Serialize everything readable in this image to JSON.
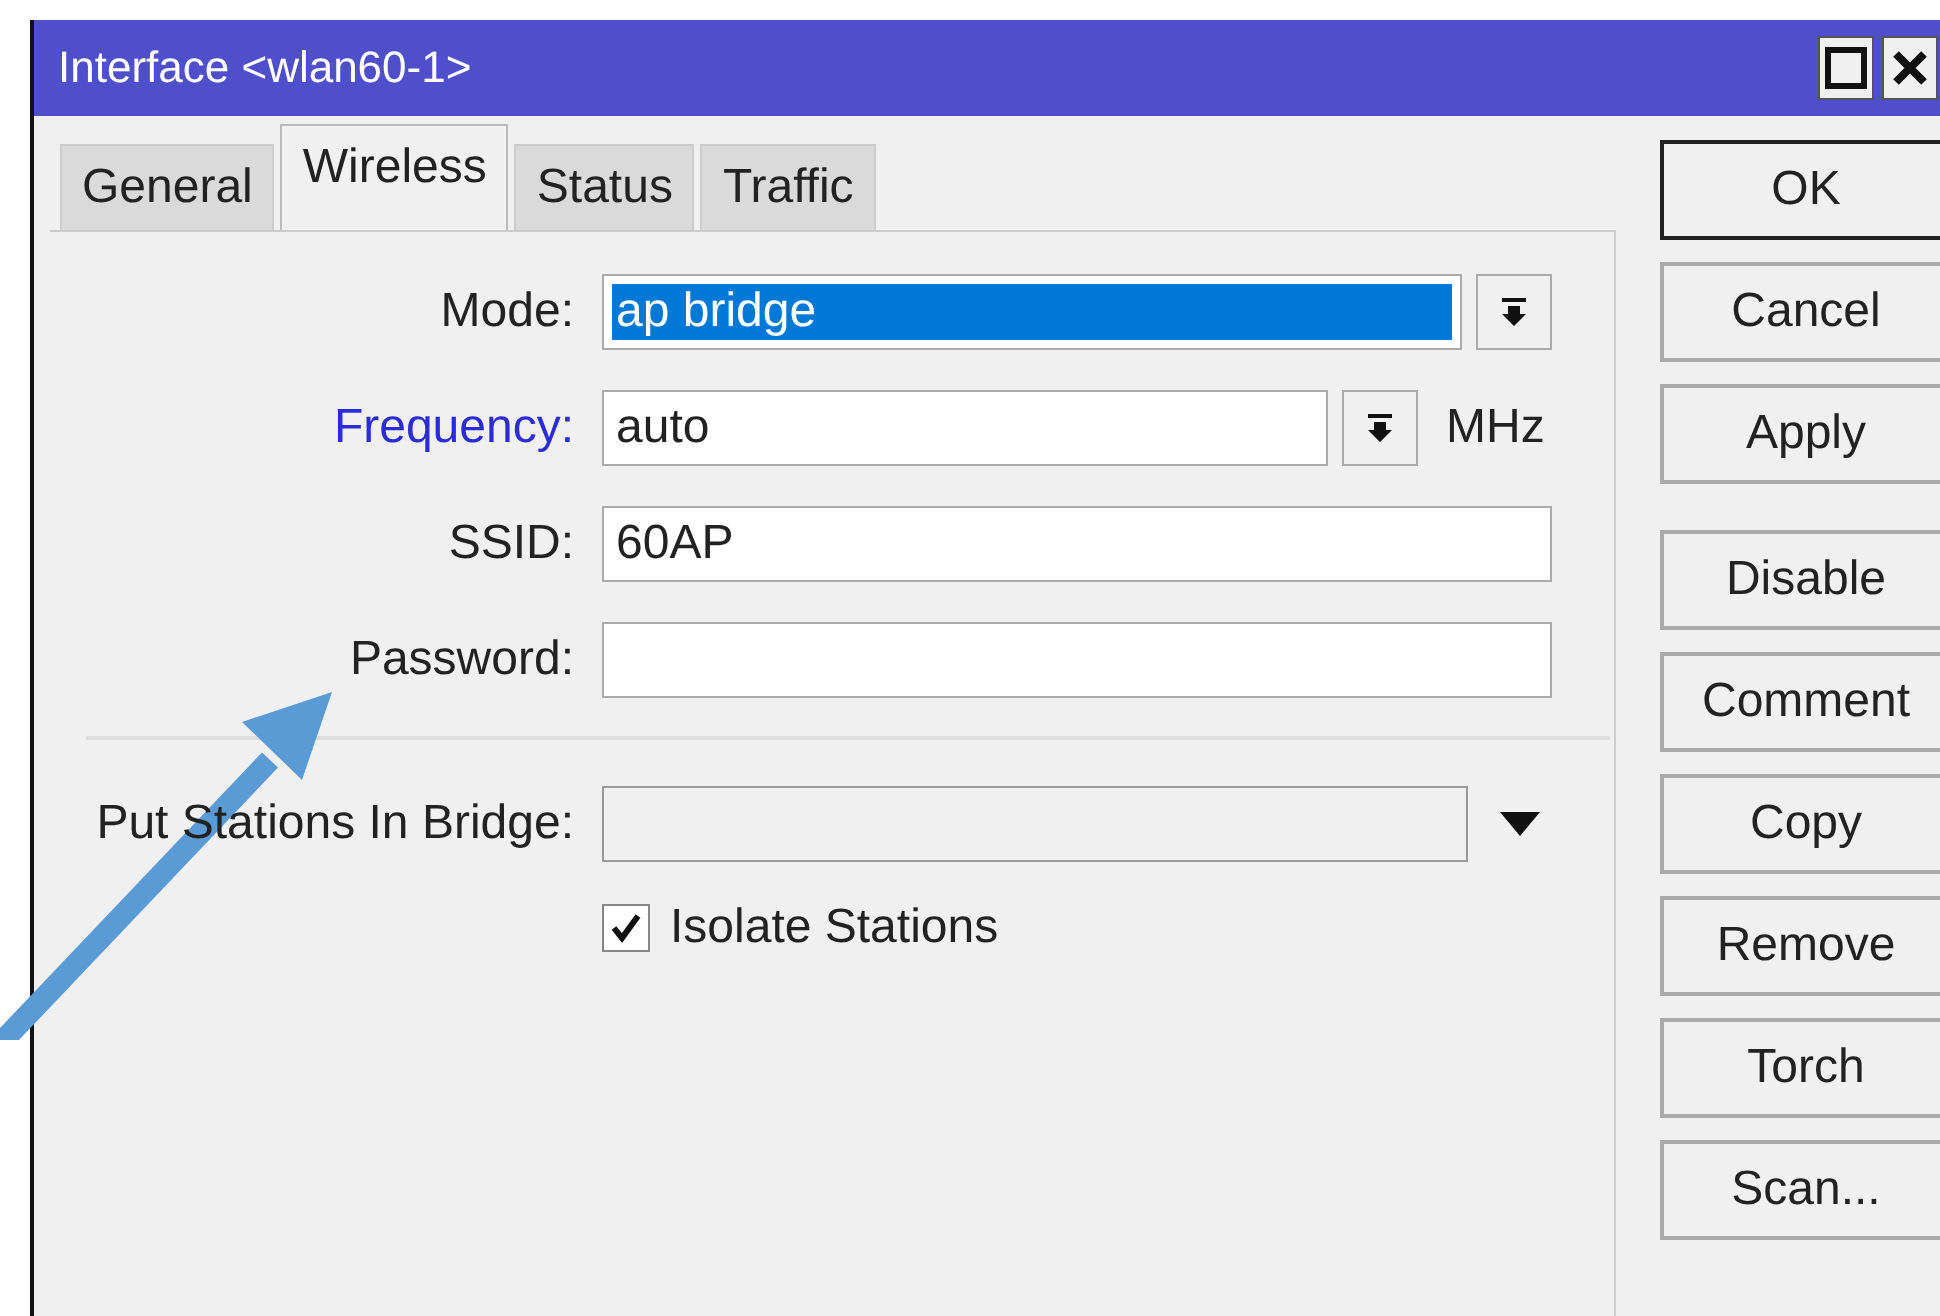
{
  "window": {
    "title": "Interface <wlan60-1>"
  },
  "tabs": [
    {
      "label": "General",
      "selected": false
    },
    {
      "label": "Wireless",
      "selected": true
    },
    {
      "label": "Status",
      "selected": false
    },
    {
      "label": "Traffic",
      "selected": false
    }
  ],
  "fields": [
    {
      "kind": "combo",
      "label": "Mode:",
      "color": "#222222",
      "value": "ap bridge",
      "value_selected": true
    },
    {
      "kind": "combo",
      "label": "Frequency:",
      "color": "#2b2bd8",
      "value": "auto",
      "value_selected": false,
      "unit": "MHz"
    },
    {
      "kind": "text",
      "label": "SSID:",
      "color": "#222222",
      "value": "60AP"
    },
    {
      "kind": "text",
      "label": "Password:",
      "color": "#222222"
    },
    {
      "kind": "separator"
    },
    {
      "kind": "dropdown",
      "label": "Put Stations In Bridge:",
      "color": "#222222"
    },
    {
      "kind": "checkbox",
      "label": "Isolate Stations",
      "checked": true
    }
  ],
  "button_groups": [
    [
      {
        "label": "OK",
        "default": true
      },
      {
        "label": "Cancel",
        "default": false
      },
      {
        "label": "Apply",
        "default": false
      }
    ],
    [
      {
        "label": "Disable",
        "default": false
      },
      {
        "label": "Comment",
        "default": false
      },
      {
        "label": "Copy",
        "default": false
      },
      {
        "label": "Remove",
        "default": false
      },
      {
        "label": "Torch",
        "default": false
      },
      {
        "label": "Scan...",
        "default": false
      }
    ]
  ]
}
